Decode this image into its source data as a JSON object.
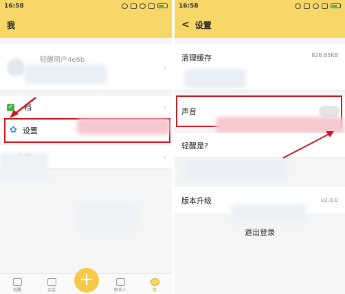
{
  "left": {
    "status": {
      "time": "16:58"
    },
    "title": "我",
    "user_name": "轻醒用户4e6b",
    "files_label": "档",
    "settings_label": "设置",
    "emoji_label": "表情",
    "tabs": [
      {
        "label": "轻醒",
        "icon": "list-icon"
      },
      {
        "label": "会话",
        "icon": "chat-icon"
      },
      {
        "label": "",
        "icon": "plus-icon"
      },
      {
        "label": "联系人",
        "icon": "contacts-icon"
      },
      {
        "label": "我",
        "icon": "me-icon"
      }
    ],
    "fab": "+"
  },
  "right": {
    "status": {
      "time": "16:58"
    },
    "title": "设置",
    "back": "<",
    "clear_cache_label": "清理缓存",
    "clear_cache_value": "826.85KB",
    "sound_label": "声音",
    "about_label": "轻醒是?",
    "upgrade_label": "版本升级",
    "upgrade_value": "v2.0.0",
    "logout_label": "退出登录"
  },
  "colors": {
    "accent": "#f7d768",
    "highlight": "#c9161c",
    "fab": "#f7c948"
  }
}
